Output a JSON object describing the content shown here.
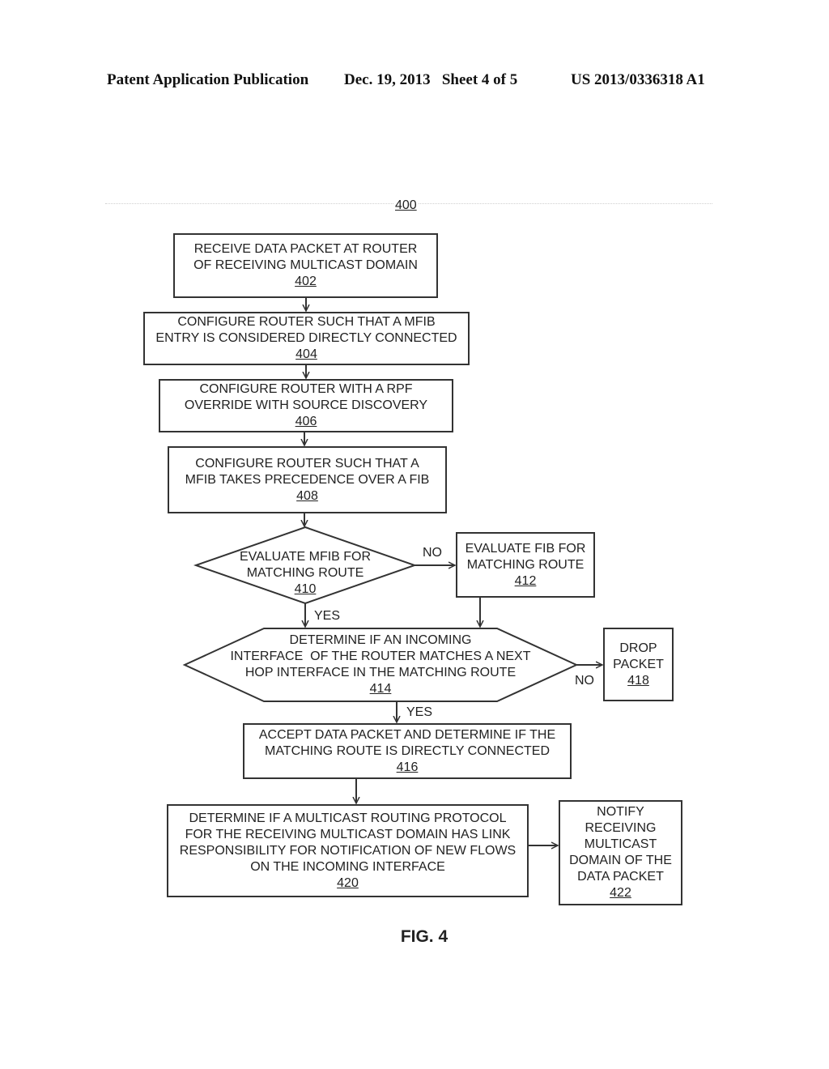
{
  "header": {
    "publication": "Patent Application Publication",
    "date_sheet": "Dec. 19, 2013   Sheet 4 of 5",
    "patent_number": "US 2013/0336318 A1"
  },
  "diagram": {
    "ref": "400",
    "figure_label": "FIG. 4",
    "colors": {
      "stroke": "#333333",
      "text": "#222222",
      "background": "#ffffff"
    },
    "nodes": {
      "n402": {
        "lines": [
          "RECEIVE DATA PACKET AT ROUTER",
          "OF RECEIVING MULTICAST DOMAIN"
        ],
        "ref": "402",
        "shape": "rectangle"
      },
      "n404": {
        "lines": [
          "CONFIGURE ROUTER SUCH THAT A MFIB",
          "ENTRY IS CONSIDERED DIRECTLY CONNECTED"
        ],
        "ref": "404",
        "shape": "rectangle"
      },
      "n406": {
        "lines": [
          "CONFIGURE ROUTER WITH A RPF",
          "OVERRIDE WITH SOURCE DISCOVERY"
        ],
        "ref": "406",
        "shape": "rectangle"
      },
      "n408": {
        "lines": [
          "CONFIGURE ROUTER SUCH THAT A",
          "MFIB TAKES PRECEDENCE OVER A FIB"
        ],
        "ref": "408",
        "shape": "rectangle"
      },
      "n410": {
        "lines": [
          "EVALUATE MFIB FOR",
          "MATCHING ROUTE"
        ],
        "ref": "410",
        "shape": "diamond"
      },
      "n412": {
        "lines": [
          "EVALUATE FIB FOR",
          "MATCHING ROUTE"
        ],
        "ref": "412",
        "shape": "rectangle"
      },
      "n414": {
        "lines": [
          "DETERMINE IF AN INCOMING",
          "INTERFACE  OF THE ROUTER MATCHES A NEXT",
          "HOP INTERFACE IN THE MATCHING ROUTE"
        ],
        "ref": "414",
        "shape": "hexagon"
      },
      "n416": {
        "lines": [
          "ACCEPT DATA PACKET AND DETERMINE IF THE",
          "MATCHING ROUTE IS DIRECTLY CONNECTED"
        ],
        "ref": "416",
        "shape": "rectangle"
      },
      "n418": {
        "lines": [
          "DROP",
          "PACKET"
        ],
        "ref": "418",
        "shape": "rectangle"
      },
      "n420": {
        "lines": [
          "DETERMINE IF A MULTICAST ROUTING PROTOCOL",
          "FOR THE RECEIVING MULTICAST DOMAIN HAS LINK",
          "RESPONSIBILITY FOR NOTIFICATION OF NEW FLOWS",
          "ON THE INCOMING INTERFACE"
        ],
        "ref": "420",
        "shape": "rectangle"
      },
      "n422": {
        "lines": [
          "NOTIFY",
          "RECEIVING",
          "MULTICAST",
          "DOMAIN OF THE",
          "DATA PACKET"
        ],
        "ref": "422",
        "shape": "rectangle"
      }
    },
    "edges": [
      {
        "from": "402",
        "to": "404",
        "label": ""
      },
      {
        "from": "404",
        "to": "406",
        "label": ""
      },
      {
        "from": "406",
        "to": "408",
        "label": ""
      },
      {
        "from": "408",
        "to": "410",
        "label": ""
      },
      {
        "from": "410",
        "to": "412",
        "label": "NO"
      },
      {
        "from": "410",
        "to": "414",
        "label": "YES"
      },
      {
        "from": "412",
        "to": "414",
        "label": ""
      },
      {
        "from": "414",
        "to": "418",
        "label": "NO"
      },
      {
        "from": "414",
        "to": "416",
        "label": "YES"
      },
      {
        "from": "416",
        "to": "420",
        "label": ""
      },
      {
        "from": "420",
        "to": "422",
        "label": ""
      }
    ],
    "edge_labels": {
      "no_410": "NO",
      "yes_410": "YES",
      "no_414": "NO",
      "yes_414": "YES"
    }
  }
}
